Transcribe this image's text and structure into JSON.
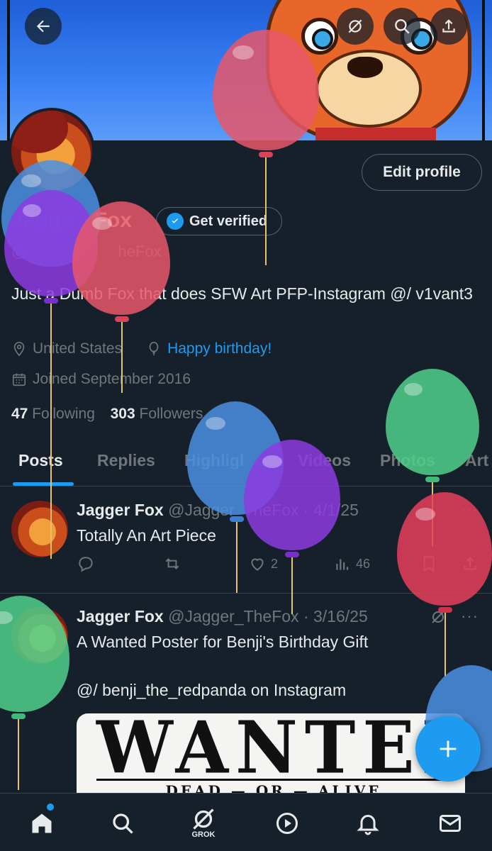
{
  "header": {
    "back_icon": "arrow-left-icon",
    "grok_icon": "grok-slash-icon",
    "search_icon": "search-icon",
    "share_icon": "share-icon"
  },
  "profile": {
    "edit_button": "Edit profile",
    "name_part1": "Jagge",
    "name_part2": "Fox",
    "get_verified": "Get verified",
    "handle_part1": "@",
    "handle_part2": "heFox",
    "bio": "Just a Dumb Fox that does SFW Art PFP-Instagram @/ v1vant3",
    "location": "United States",
    "birthday": "Happy birthday!",
    "joined": "Joined September 2016",
    "following_count": "47",
    "following_label": "Following",
    "followers_count": "303",
    "followers_label": "Followers"
  },
  "tabs": [
    "Posts",
    "Replies",
    "Highligl",
    "Videos",
    "Photos",
    "Art"
  ],
  "posts": [
    {
      "name": "Jagger Fox",
      "handle": "@Jagger_TheFox",
      "date": "· 4/1/25",
      "text": "Totally An Art Piece",
      "likes": "2",
      "views": "46"
    },
    {
      "name": "Jagger Fox",
      "handle": "@Jagger_TheFox",
      "date": "· 3/16/25",
      "text": "A Wanted Poster for Benji's Birthday Gift\n\n@/ benji_the_redpanda  on Instagram",
      "image_title": "WANTED",
      "image_subtitle": "DEAD — OR — ALIVE"
    }
  ],
  "bottom_nav": {
    "grok_label": "GROK",
    "items": [
      "home-icon",
      "search-icon",
      "grok-icon",
      "play-icon",
      "bell-icon",
      "mail-icon"
    ]
  },
  "colors": {
    "background": "#15202b",
    "accent": "#1d9bf0",
    "muted": "#71767b",
    "border": "#38444d"
  }
}
